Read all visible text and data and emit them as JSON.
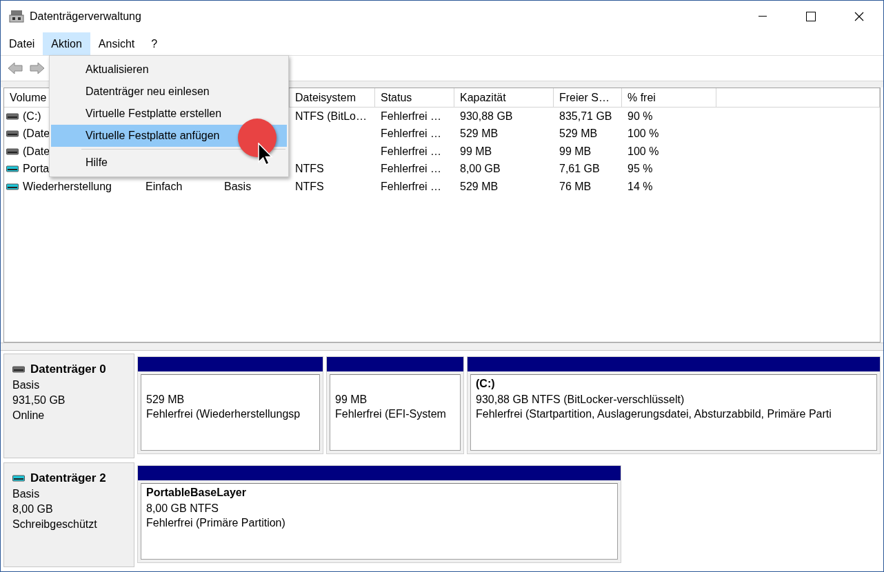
{
  "window": {
    "title": "Datenträgerverwaltung"
  },
  "menu_bar": [
    {
      "label": "Datei",
      "selected": false
    },
    {
      "label": "Aktion",
      "selected": true
    },
    {
      "label": "Ansicht",
      "selected": false
    },
    {
      "label": "?",
      "selected": false
    }
  ],
  "dropdown_menu": [
    {
      "kind": "item",
      "label": "Aktualisieren",
      "selected": false
    },
    {
      "kind": "item",
      "label": "Datenträger neu einlesen",
      "selected": false
    },
    {
      "kind": "item",
      "label": "Virtuelle Festplatte erstellen",
      "selected": false
    },
    {
      "kind": "item",
      "label": "Virtuelle Festplatte anfügen",
      "selected": true
    },
    {
      "kind": "separator"
    },
    {
      "kind": "item",
      "label": "Hilfe",
      "selected": false
    }
  ],
  "volume_table": {
    "columns": {
      "volume": "Volume",
      "dateisystem": "Dateisystem",
      "status": "Status",
      "kapazitaet": "Kapazität",
      "freier_speicher": "Freier S…",
      "prozent_frei": "% frei"
    },
    "rows": [
      {
        "kind": "fixed",
        "volume": "(C:)",
        "dateisystem": "NTFS (BitLo…",
        "status": "Fehlerfrei …",
        "kapazitaet": "930,88 GB",
        "freier_speicher": "835,71 GB",
        "prozent_frei": "90 %"
      },
      {
        "kind": "fixed",
        "volume": "(Date",
        "status": "Fehlerfrei …",
        "kapazitaet": "529 MB",
        "freier_speicher": "529 MB",
        "prozent_frei": "100 %"
      },
      {
        "kind": "fixed",
        "volume": "(Date",
        "status": "Fehlerfrei …",
        "kapazitaet": "99 MB",
        "freier_speicher": "99 MB",
        "prozent_frei": "100 %"
      },
      {
        "kind": "removable",
        "volume": "Porta",
        "dateisystem": "NTFS",
        "status": "Fehlerfrei …",
        "kapazitaet": "8,00 GB",
        "freier_speicher": "7,61 GB",
        "prozent_frei": "95 %"
      },
      {
        "kind": "removable",
        "volume": "Wiederherstellung",
        "column_2": "Einfach",
        "column_3": "Basis",
        "dateisystem": "NTFS",
        "status": "Fehlerfrei …",
        "kapazitaet": "529 MB",
        "freier_speicher": "76 MB",
        "prozent_frei": "14 %"
      }
    ]
  },
  "disks": [
    {
      "kind": "fixed",
      "name": "Datenträger 0",
      "lines": [
        "Basis",
        "931,50 GB",
        "Online"
      ],
      "partitions": [
        {
          "lines": [
            "529 MB",
            "Fehlerfrei (Wiederherstellungsp"
          ]
        },
        {
          "lines": [
            "99 MB",
            "Fehlerfrei (EFI-System"
          ]
        },
        {
          "title": "(C:)",
          "lines": [
            "930,88 GB NTFS (BitLocker-verschlüsselt)",
            "Fehlerfrei (Startpartition, Auslagerungsdatei, Absturzabbild, Primäre Parti"
          ]
        }
      ]
    },
    {
      "kind": "removable",
      "name": "Datenträger 2",
      "lines": [
        "Basis",
        "8,00 GB",
        "Schreibgeschützt"
      ],
      "partitions": [
        {
          "title": "PortableBaseLayer",
          "lines": [
            "8,00 GB NTFS",
            "Fehlerfrei (Primäre Partition)"
          ]
        }
      ]
    }
  ]
}
